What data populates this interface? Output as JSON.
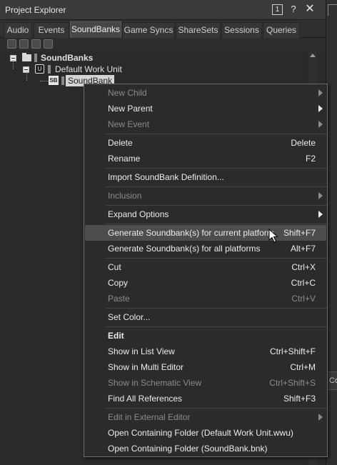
{
  "window": {
    "title": "Project Explorer",
    "count_badge": "1",
    "help_glyph": "?",
    "close_glyph": "✕"
  },
  "right_strip": {
    "label": "Co"
  },
  "tabs": [
    {
      "label": "Audio"
    },
    {
      "label": "Events"
    },
    {
      "label": "SoundBanks"
    },
    {
      "label": "Game Syncs"
    },
    {
      "label": "ShareSets"
    },
    {
      "label": "Sessions"
    },
    {
      "label": "Queries"
    }
  ],
  "active_tab": "SoundBanks",
  "toolbar_icons": [
    "work-unit-icon",
    "folder-icon",
    "virtual-folder-icon",
    "soundbank-icon"
  ],
  "tree": {
    "root_label": "SoundBanks",
    "work_unit_label": "Default Work Unit",
    "soundbank_label": "SoundBank"
  },
  "context_menu": {
    "items": [
      {
        "label": "New Child",
        "shortcut": "",
        "disabled": true,
        "submenu": true
      },
      {
        "label": "New Parent",
        "shortcut": "",
        "disabled": false,
        "submenu": true
      },
      {
        "label": "New Event",
        "shortcut": "",
        "disabled": true,
        "submenu": true
      },
      {
        "label": "Delete",
        "shortcut": "Delete",
        "disabled": false,
        "submenu": false
      },
      {
        "label": "Rename",
        "shortcut": "F2",
        "disabled": false,
        "submenu": false
      },
      {
        "label": "Import SoundBank Definition...",
        "shortcut": "",
        "disabled": false,
        "submenu": false
      },
      {
        "label": "Inclusion",
        "shortcut": "",
        "disabled": true,
        "submenu": true
      },
      {
        "label": "Expand Options",
        "shortcut": "",
        "disabled": false,
        "submenu": true
      },
      {
        "label": "Generate Soundbank(s) for current platform",
        "shortcut": "Shift+F7",
        "disabled": false,
        "submenu": false,
        "highlighted": true
      },
      {
        "label": "Generate Soundbank(s) for all platforms",
        "shortcut": "Alt+F7",
        "disabled": false,
        "submenu": false
      },
      {
        "label": "Cut",
        "shortcut": "Ctrl+X",
        "disabled": false,
        "submenu": false
      },
      {
        "label": "Copy",
        "shortcut": "Ctrl+C",
        "disabled": false,
        "submenu": false
      },
      {
        "label": "Paste",
        "shortcut": "Ctrl+V",
        "disabled": true,
        "submenu": false
      },
      {
        "label": "Set Color...",
        "shortcut": "",
        "disabled": false,
        "submenu": false
      },
      {
        "label": "Edit",
        "shortcut": "",
        "disabled": false,
        "submenu": false,
        "bold": true
      },
      {
        "label": "Show in List View",
        "shortcut": "Ctrl+Shift+F",
        "disabled": false,
        "submenu": false
      },
      {
        "label": "Show in Multi Editor",
        "shortcut": "Ctrl+M",
        "disabled": false,
        "submenu": false
      },
      {
        "label": "Show in Schematic View",
        "shortcut": "Ctrl+Shift+S",
        "disabled": true,
        "submenu": false
      },
      {
        "label": "Find All References",
        "shortcut": "Shift+F3",
        "disabled": false,
        "submenu": false
      },
      {
        "label": "Edit in External Editor",
        "shortcut": "",
        "disabled": true,
        "submenu": true
      },
      {
        "label": "Open Containing Folder (Default Work Unit.wwu)",
        "shortcut": "",
        "disabled": false,
        "submenu": false
      },
      {
        "label": "Open Containing Folder (SoundBank.bnk)",
        "shortcut": "",
        "disabled": false,
        "submenu": false
      }
    ]
  },
  "colors": {
    "background": "#2b2b2b",
    "menu_highlight": "#4d4d4d",
    "text": "#ececec",
    "disabled_text": "#8b8b8b"
  }
}
